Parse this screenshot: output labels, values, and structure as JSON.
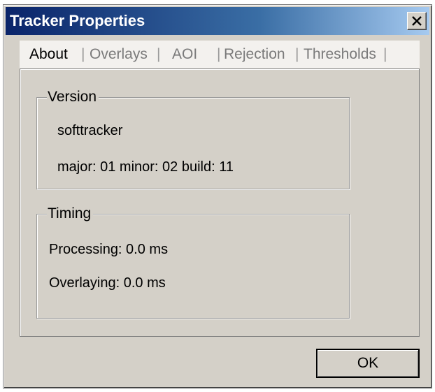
{
  "window": {
    "title": "Tracker Properties",
    "close_icon": "close-icon"
  },
  "tabs": [
    {
      "label": "About",
      "active": true
    },
    {
      "label": "Overlays",
      "active": false
    },
    {
      "label": "AOI",
      "active": false
    },
    {
      "label": "Rejection",
      "active": false
    },
    {
      "label": "Thresholds",
      "active": false
    }
  ],
  "version_group": {
    "legend": "Version",
    "name": "softtracker",
    "version_line": "major: 01  minor: 02  build: 11"
  },
  "timing_group": {
    "legend": "Timing",
    "processing": "Processing: 0.0 ms",
    "overlaying": "Overlaying: 0.0 ms"
  },
  "buttons": {
    "ok_label": "OK"
  },
  "colors": {
    "dialog_face": "#d4d0c8",
    "titlebar_start": "#0a246a",
    "titlebar_end": "#a6caf0",
    "inactive_tab_text": "#7a7a7a"
  }
}
